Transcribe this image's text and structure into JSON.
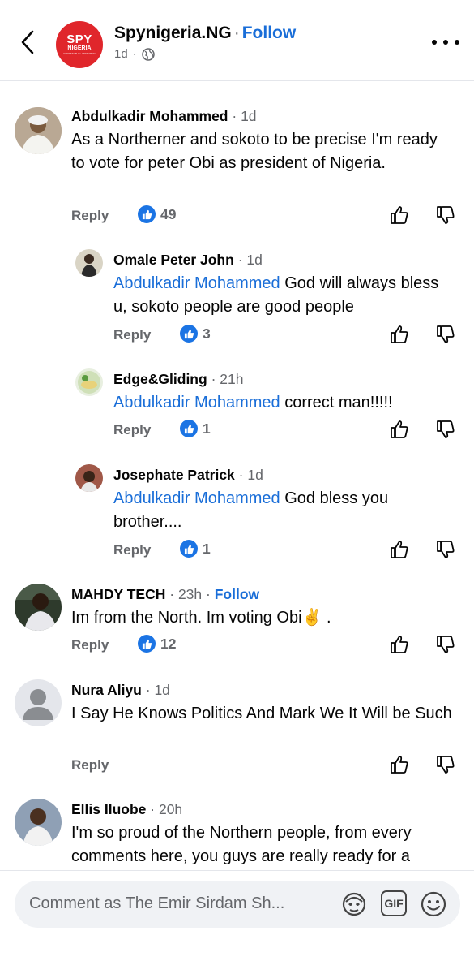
{
  "header": {
    "page_name": "Spynigeria.NG",
    "separator": "·",
    "follow_label": "Follow",
    "time": "1d",
    "logo": {
      "line1": "SPY",
      "line2": "NIGERIA",
      "line3": "FAST FACTUAL UNFEARED"
    }
  },
  "comments": [
    {
      "name": "Abdulkadir Mohammed",
      "time": "1d",
      "text": "As a Northerner and sokoto to be precise I'm ready to vote for peter Obi as president of Nigeria.",
      "reply_label": "Reply",
      "reactions": "49",
      "avatar_color": "#8a7460"
    },
    {
      "name": "Omale Peter John",
      "time": "1d",
      "mention": "Abdulkadir Mohammed",
      "text": "God will always bless u, sokoto people are good people",
      "reply_label": "Reply",
      "reactions": "3",
      "avatar_color": "#6b6b5a"
    },
    {
      "name": "Edge&Gliding",
      "time": "21h",
      "mention": "Abdulkadir Mohammed",
      "text": "correct man!!!!!",
      "reply_label": "Reply",
      "reactions": "1",
      "avatar_color": "#c9d8b0"
    },
    {
      "name": "Josephate Patrick",
      "time": "1d",
      "mention": "Abdulkadir Mohammed",
      "text": "God bless you brother....",
      "reply_label": "Reply",
      "reactions": "1",
      "avatar_color": "#8a5a4a"
    },
    {
      "name": "MAHDY TECH",
      "time": "23h",
      "follow_label": "Follow",
      "text": "Im from the North. Im voting Obi✌️ .",
      "reply_label": "Reply",
      "reactions": "12",
      "avatar_color": "#3d4a3a"
    },
    {
      "name": "Nura Aliyu",
      "time": "1d",
      "text": "I Say He Knows Politics And Mark We It Will be Such",
      "reply_label": "Reply",
      "avatar_color": "#c8ccd2"
    },
    {
      "name": "Ellis Iluobe",
      "time": "20h",
      "text": "I'm so proud of the Northern people, from every comments here, you guys are really ready for a",
      "avatar_color": "#6a5a50"
    }
  ],
  "composer": {
    "placeholder": "Comment as The Emir Sirdam Sh...",
    "gif_label": "GIF"
  },
  "colors": {
    "accent": "#1a6ed8",
    "like": "#1b74e4",
    "brand_red": "#e0262b"
  }
}
